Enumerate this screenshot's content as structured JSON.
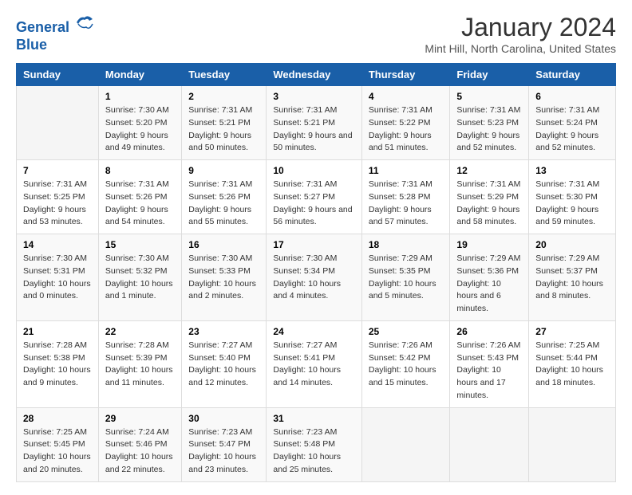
{
  "header": {
    "logo_line1": "General",
    "logo_line2": "Blue",
    "month": "January 2024",
    "location": "Mint Hill, North Carolina, United States"
  },
  "weekdays": [
    "Sunday",
    "Monday",
    "Tuesday",
    "Wednesday",
    "Thursday",
    "Friday",
    "Saturday"
  ],
  "weeks": [
    [
      {
        "day": "",
        "sunrise": "",
        "sunset": "",
        "daylight": ""
      },
      {
        "day": "1",
        "sunrise": "Sunrise: 7:30 AM",
        "sunset": "Sunset: 5:20 PM",
        "daylight": "Daylight: 9 hours and 49 minutes."
      },
      {
        "day": "2",
        "sunrise": "Sunrise: 7:31 AM",
        "sunset": "Sunset: 5:21 PM",
        "daylight": "Daylight: 9 hours and 50 minutes."
      },
      {
        "day": "3",
        "sunrise": "Sunrise: 7:31 AM",
        "sunset": "Sunset: 5:21 PM",
        "daylight": "Daylight: 9 hours and 50 minutes."
      },
      {
        "day": "4",
        "sunrise": "Sunrise: 7:31 AM",
        "sunset": "Sunset: 5:22 PM",
        "daylight": "Daylight: 9 hours and 51 minutes."
      },
      {
        "day": "5",
        "sunrise": "Sunrise: 7:31 AM",
        "sunset": "Sunset: 5:23 PM",
        "daylight": "Daylight: 9 hours and 52 minutes."
      },
      {
        "day": "6",
        "sunrise": "Sunrise: 7:31 AM",
        "sunset": "Sunset: 5:24 PM",
        "daylight": "Daylight: 9 hours and 52 minutes."
      }
    ],
    [
      {
        "day": "7",
        "sunrise": "Sunrise: 7:31 AM",
        "sunset": "Sunset: 5:25 PM",
        "daylight": "Daylight: 9 hours and 53 minutes."
      },
      {
        "day": "8",
        "sunrise": "Sunrise: 7:31 AM",
        "sunset": "Sunset: 5:26 PM",
        "daylight": "Daylight: 9 hours and 54 minutes."
      },
      {
        "day": "9",
        "sunrise": "Sunrise: 7:31 AM",
        "sunset": "Sunset: 5:26 PM",
        "daylight": "Daylight: 9 hours and 55 minutes."
      },
      {
        "day": "10",
        "sunrise": "Sunrise: 7:31 AM",
        "sunset": "Sunset: 5:27 PM",
        "daylight": "Daylight: 9 hours and 56 minutes."
      },
      {
        "day": "11",
        "sunrise": "Sunrise: 7:31 AM",
        "sunset": "Sunset: 5:28 PM",
        "daylight": "Daylight: 9 hours and 57 minutes."
      },
      {
        "day": "12",
        "sunrise": "Sunrise: 7:31 AM",
        "sunset": "Sunset: 5:29 PM",
        "daylight": "Daylight: 9 hours and 58 minutes."
      },
      {
        "day": "13",
        "sunrise": "Sunrise: 7:31 AM",
        "sunset": "Sunset: 5:30 PM",
        "daylight": "Daylight: 9 hours and 59 minutes."
      }
    ],
    [
      {
        "day": "14",
        "sunrise": "Sunrise: 7:30 AM",
        "sunset": "Sunset: 5:31 PM",
        "daylight": "Daylight: 10 hours and 0 minutes."
      },
      {
        "day": "15",
        "sunrise": "Sunrise: 7:30 AM",
        "sunset": "Sunset: 5:32 PM",
        "daylight": "Daylight: 10 hours and 1 minute."
      },
      {
        "day": "16",
        "sunrise": "Sunrise: 7:30 AM",
        "sunset": "Sunset: 5:33 PM",
        "daylight": "Daylight: 10 hours and 2 minutes."
      },
      {
        "day": "17",
        "sunrise": "Sunrise: 7:30 AM",
        "sunset": "Sunset: 5:34 PM",
        "daylight": "Daylight: 10 hours and 4 minutes."
      },
      {
        "day": "18",
        "sunrise": "Sunrise: 7:29 AM",
        "sunset": "Sunset: 5:35 PM",
        "daylight": "Daylight: 10 hours and 5 minutes."
      },
      {
        "day": "19",
        "sunrise": "Sunrise: 7:29 AM",
        "sunset": "Sunset: 5:36 PM",
        "daylight": "Daylight: 10 hours and 6 minutes."
      },
      {
        "day": "20",
        "sunrise": "Sunrise: 7:29 AM",
        "sunset": "Sunset: 5:37 PM",
        "daylight": "Daylight: 10 hours and 8 minutes."
      }
    ],
    [
      {
        "day": "21",
        "sunrise": "Sunrise: 7:28 AM",
        "sunset": "Sunset: 5:38 PM",
        "daylight": "Daylight: 10 hours and 9 minutes."
      },
      {
        "day": "22",
        "sunrise": "Sunrise: 7:28 AM",
        "sunset": "Sunset: 5:39 PM",
        "daylight": "Daylight: 10 hours and 11 minutes."
      },
      {
        "day": "23",
        "sunrise": "Sunrise: 7:27 AM",
        "sunset": "Sunset: 5:40 PM",
        "daylight": "Daylight: 10 hours and 12 minutes."
      },
      {
        "day": "24",
        "sunrise": "Sunrise: 7:27 AM",
        "sunset": "Sunset: 5:41 PM",
        "daylight": "Daylight: 10 hours and 14 minutes."
      },
      {
        "day": "25",
        "sunrise": "Sunrise: 7:26 AM",
        "sunset": "Sunset: 5:42 PM",
        "daylight": "Daylight: 10 hours and 15 minutes."
      },
      {
        "day": "26",
        "sunrise": "Sunrise: 7:26 AM",
        "sunset": "Sunset: 5:43 PM",
        "daylight": "Daylight: 10 hours and 17 minutes."
      },
      {
        "day": "27",
        "sunrise": "Sunrise: 7:25 AM",
        "sunset": "Sunset: 5:44 PM",
        "daylight": "Daylight: 10 hours and 18 minutes."
      }
    ],
    [
      {
        "day": "28",
        "sunrise": "Sunrise: 7:25 AM",
        "sunset": "Sunset: 5:45 PM",
        "daylight": "Daylight: 10 hours and 20 minutes."
      },
      {
        "day": "29",
        "sunrise": "Sunrise: 7:24 AM",
        "sunset": "Sunset: 5:46 PM",
        "daylight": "Daylight: 10 hours and 22 minutes."
      },
      {
        "day": "30",
        "sunrise": "Sunrise: 7:23 AM",
        "sunset": "Sunset: 5:47 PM",
        "daylight": "Daylight: 10 hours and 23 minutes."
      },
      {
        "day": "31",
        "sunrise": "Sunrise: 7:23 AM",
        "sunset": "Sunset: 5:48 PM",
        "daylight": "Daylight: 10 hours and 25 minutes."
      },
      {
        "day": "",
        "sunrise": "",
        "sunset": "",
        "daylight": ""
      },
      {
        "day": "",
        "sunrise": "",
        "sunset": "",
        "daylight": ""
      },
      {
        "day": "",
        "sunrise": "",
        "sunset": "",
        "daylight": ""
      }
    ]
  ]
}
